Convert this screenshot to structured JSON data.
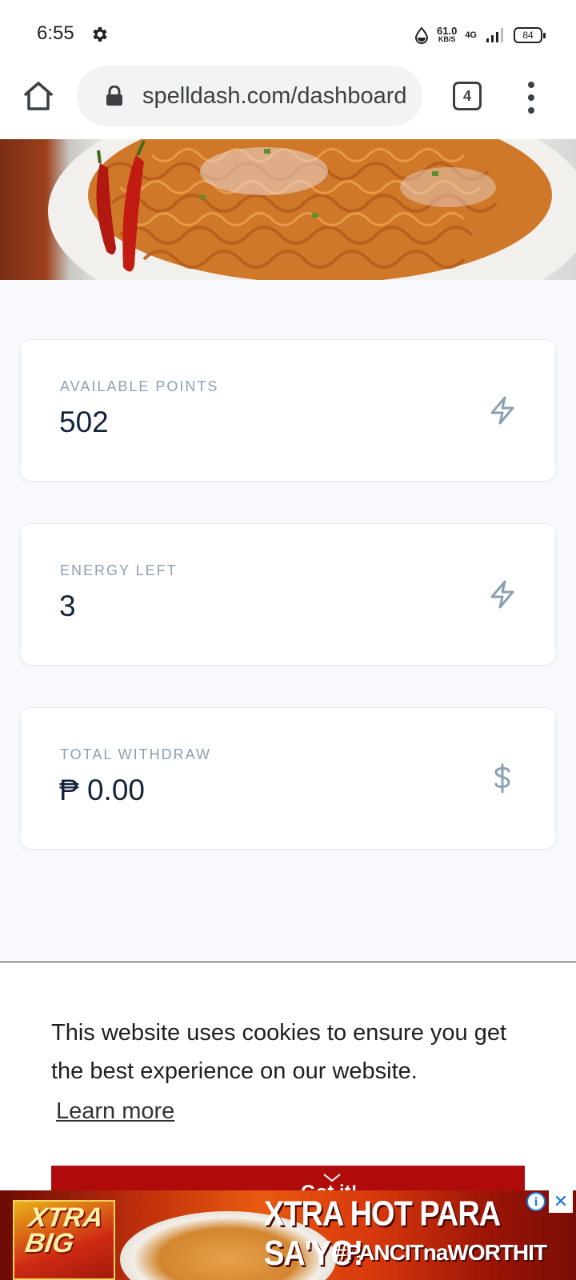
{
  "status_bar": {
    "time": "6:55",
    "speed_value": "61.0",
    "speed_unit": "KB/S",
    "network": "4G",
    "battery": "84"
  },
  "browser": {
    "url": "spelldash.com/dashboard",
    "tab_count": "4"
  },
  "stats": [
    {
      "label": "AVAILABLE POINTS",
      "value": "502",
      "icon": "lightning-icon"
    },
    {
      "label": "ENERGY LEFT",
      "value": "3",
      "icon": "lightning-icon"
    },
    {
      "label": "TOTAL WITHDRAW",
      "value": "₱ 0.00",
      "icon": "dollar-icon"
    }
  ],
  "cookie_banner": {
    "message": "This website uses cookies to ensure you get the best experience on our website.",
    "learn_more": "Learn more",
    "button_label": "Got it!"
  },
  "ad": {
    "pack_text": "XTRA BIG",
    "headline": "XTRA HOT PARA SA'YO!",
    "hashtag": "#PANCITnaWORTHIT",
    "info_icon": "info-icon",
    "close_icon": "close-icon"
  },
  "colors": {
    "card_label": "#8ca0b3",
    "card_value": "#14243a",
    "cookie_button": "#b00b0b"
  }
}
